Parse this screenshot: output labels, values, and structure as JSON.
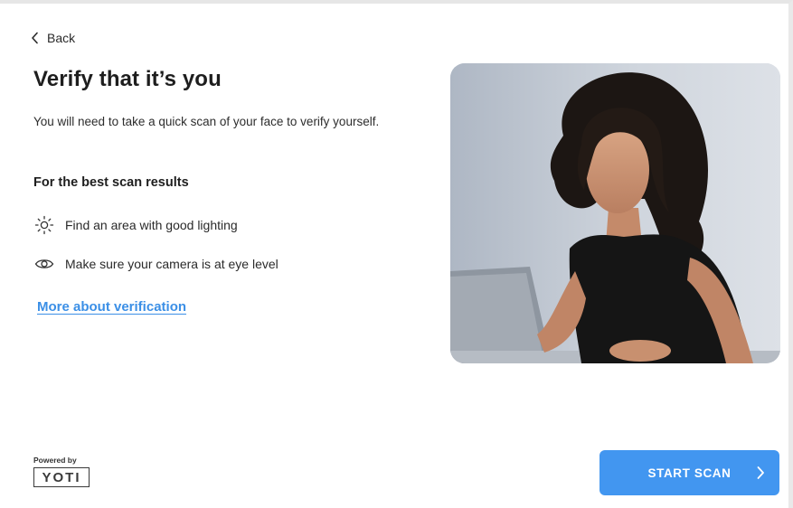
{
  "nav": {
    "back_label": "Back",
    "back_icon": "chevron-left-icon"
  },
  "header": {
    "title": "Verify that it’s you"
  },
  "intro": {
    "description": "You will need to take a quick scan of your face to verify yourself."
  },
  "tips": {
    "heading": "For the best scan results",
    "items": [
      {
        "icon": "sun-icon",
        "label": "Find an area with good lighting"
      },
      {
        "icon": "eye-icon",
        "label": "Make sure your camera is at eye level"
      }
    ]
  },
  "links": {
    "more_about": "More about verification"
  },
  "footer": {
    "powered_by": "Powered by",
    "brand_logo": "YOTI",
    "start_button": "START SCAN",
    "start_icon": "chevron-right-icon"
  },
  "colors": {
    "accent": "#4296f0",
    "link": "#3b8fe6",
    "text": "#1e1e1e",
    "background": "#ffffff"
  }
}
